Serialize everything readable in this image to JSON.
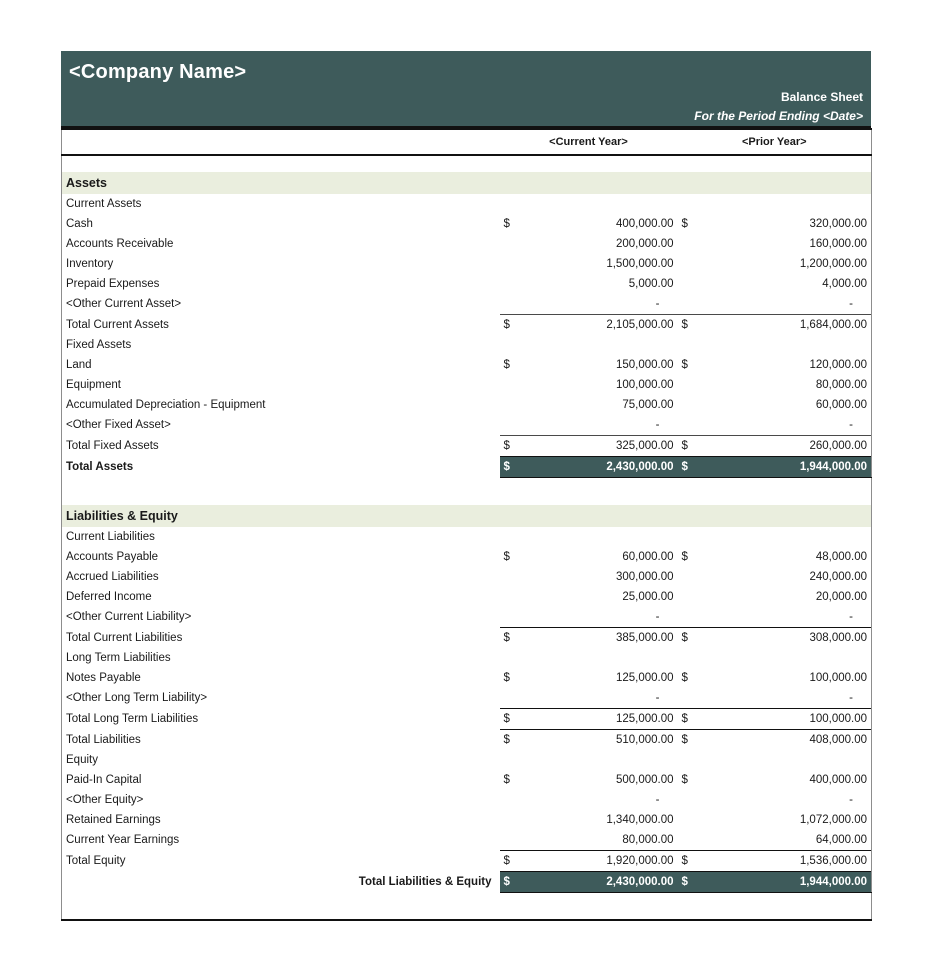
{
  "colors": {
    "brand_teal": "#3e5b5b",
    "section_band": "#eaeede",
    "rule": "#111111"
  },
  "header": {
    "company_name": "<Company Name>",
    "doc_title": "Balance Sheet",
    "period": "For the Period Ending <Date>"
  },
  "columns": {
    "label": "",
    "current_year": "<Current Year>",
    "prior_year": "<Prior Year>",
    "currency_symbol": "$",
    "zero_dash": "-"
  },
  "sections": [
    {
      "name": "Assets",
      "groups": [
        {
          "name": "Current Assets",
          "rows": [
            {
              "label": "Cash",
              "cy_sym": "$",
              "cy": "400,000.00",
              "py_sym": "$",
              "py": "320,000.00"
            },
            {
              "label": "Accounts Receivable",
              "cy_sym": "",
              "cy": "200,000.00",
              "py_sym": "",
              "py": "160,000.00"
            },
            {
              "label": "Inventory",
              "cy_sym": "",
              "cy": "1,500,000.00",
              "py_sym": "",
              "py": "1,200,000.00"
            },
            {
              "label": "Prepaid Expenses",
              "cy_sym": "",
              "cy": "5,000.00",
              "py_sym": "",
              "py": "4,000.00"
            },
            {
              "label": "<Other Current Asset>",
              "cy_sym": "",
              "cy": "-",
              "py_sym": "",
              "py": "-"
            }
          ],
          "total": {
            "label": "Total Current Assets",
            "cy_sym": "$",
            "cy": "2,105,000.00",
            "py_sym": "$",
            "py": "1,684,000.00"
          }
        },
        {
          "name": "Fixed Assets",
          "rows": [
            {
              "label": "Land",
              "cy_sym": "$",
              "cy": "150,000.00",
              "py_sym": "$",
              "py": "120,000.00"
            },
            {
              "label": "Equipment",
              "cy_sym": "",
              "cy": "100,000.00",
              "py_sym": "",
              "py": "80,000.00"
            },
            {
              "label": "Accumulated Depreciation - Equipment",
              "cy_sym": "",
              "cy": "75,000.00",
              "py_sym": "",
              "py": "60,000.00"
            },
            {
              "label": "<Other Fixed Asset>",
              "cy_sym": "",
              "cy": "-",
              "py_sym": "",
              "py": "-"
            }
          ],
          "total": {
            "label": "Total Fixed Assets",
            "cy_sym": "$",
            "cy": "325,000.00",
            "py_sym": "$",
            "py": "260,000.00"
          }
        }
      ],
      "grand_total": {
        "label": "Total Assets",
        "cy_sym": "$",
        "cy": "2,430,000.00",
        "py_sym": "$",
        "py": "1,944,000.00"
      }
    },
    {
      "name": "Liabilities & Equity",
      "groups": [
        {
          "name": "Current Liabilities",
          "rows": [
            {
              "label": "Accounts Payable",
              "cy_sym": "$",
              "cy": "60,000.00",
              "py_sym": "$",
              "py": "48,000.00"
            },
            {
              "label": "Accrued Liabilities",
              "cy_sym": "",
              "cy": "300,000.00",
              "py_sym": "",
              "py": "240,000.00"
            },
            {
              "label": "Deferred Income",
              "cy_sym": "",
              "cy": "25,000.00",
              "py_sym": "",
              "py": "20,000.00"
            },
            {
              "label": "<Other Current Liability>",
              "cy_sym": "",
              "cy": "-",
              "py_sym": "",
              "py": "-"
            }
          ],
          "total": {
            "label": "Total Current Liabilities",
            "cy_sym": "$",
            "cy": "385,000.00",
            "py_sym": "$",
            "py": "308,000.00"
          }
        },
        {
          "name": "Long Term Liabilities",
          "rows": [
            {
              "label": "Notes Payable",
              "cy_sym": "$",
              "cy": "125,000.00",
              "py_sym": "$",
              "py": "100,000.00"
            },
            {
              "label": "<Other Long Term Liability>",
              "cy_sym": "",
              "cy": "-",
              "py_sym": "",
              "py": "-"
            }
          ],
          "total": {
            "label": "Total Long Term Liabilities",
            "cy_sym": "$",
            "cy": "125,000.00",
            "py_sym": "$",
            "py": "100,000.00"
          },
          "total_all": {
            "label": "Total Liabilities",
            "cy_sym": "$",
            "cy": "510,000.00",
            "py_sym": "$",
            "py": "408,000.00"
          }
        },
        {
          "name": "Equity",
          "rows": [
            {
              "label": "Paid-In Capital",
              "cy_sym": "$",
              "cy": "500,000.00",
              "py_sym": "$",
              "py": "400,000.00"
            },
            {
              "label": "<Other Equity>",
              "cy_sym": "",
              "cy": "-",
              "py_sym": "",
              "py": "-"
            },
            {
              "label": "Retained Earnings",
              "cy_sym": "",
              "cy": "1,340,000.00",
              "py_sym": "",
              "py": "1,072,000.00"
            },
            {
              "label": "Current Year Earnings",
              "cy_sym": "",
              "cy": "80,000.00",
              "py_sym": "",
              "py": "64,000.00"
            }
          ],
          "total": {
            "label": "Total Equity",
            "cy_sym": "$",
            "cy": "1,920,000.00",
            "py_sym": "$",
            "py": "1,536,000.00"
          }
        }
      ],
      "grand_total": {
        "label": "Total Liabilities & Equity",
        "cy_sym": "$",
        "cy": "2,430,000.00",
        "py_sym": "$",
        "py": "1,944,000.00"
      }
    }
  ]
}
